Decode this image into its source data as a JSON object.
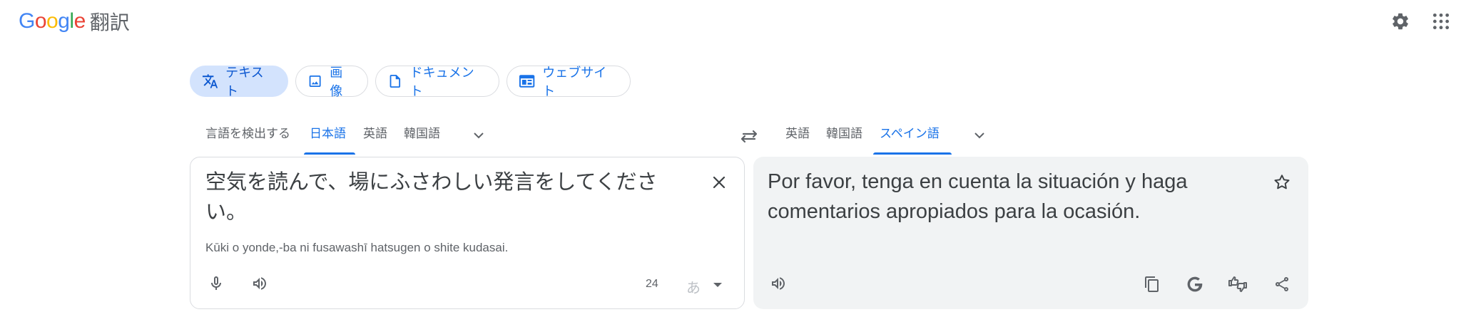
{
  "app": {
    "logo_letters": [
      "G",
      "o",
      "o",
      "g",
      "l",
      "e"
    ],
    "logo_colors": [
      "#4285f4",
      "#ea4335",
      "#fbbc05",
      "#4285f4",
      "#34a853",
      "#ea4335"
    ],
    "product_name": "翻訳"
  },
  "header": {
    "settings_icon": "gear-icon",
    "apps_icon": "apps-grid-icon"
  },
  "modes": [
    {
      "label": "テキスト",
      "icon": "translate-icon",
      "active": true
    },
    {
      "label": "画像",
      "icon": "image-icon",
      "active": false
    },
    {
      "label": "ドキュメント",
      "icon": "document-icon",
      "active": false
    },
    {
      "label": "ウェブサイト",
      "icon": "website-icon",
      "active": false
    }
  ],
  "source_languages": {
    "tabs": [
      "言語を検出する",
      "日本語",
      "英語",
      "韓国語"
    ],
    "selected": "日本語"
  },
  "target_languages": {
    "tabs": [
      "英語",
      "韓国語",
      "スペイン語"
    ],
    "selected": "スペイン語"
  },
  "source": {
    "text": "空気を読んで、場にふさわしい発言をしてください。",
    "romanization": "Kūki o yonde,-ba ni fusawashī hatsugen o shite kudasai.",
    "char_count": "24",
    "ime_label": "あ"
  },
  "target": {
    "text": "Por favor, tenga en cuenta la situación y haga comentarios apropiados para la ocasión."
  },
  "colors": {
    "accent": "#1a73e8",
    "chip_active_bg": "#d3e3fd",
    "target_panel_bg": "#f1f3f4"
  }
}
